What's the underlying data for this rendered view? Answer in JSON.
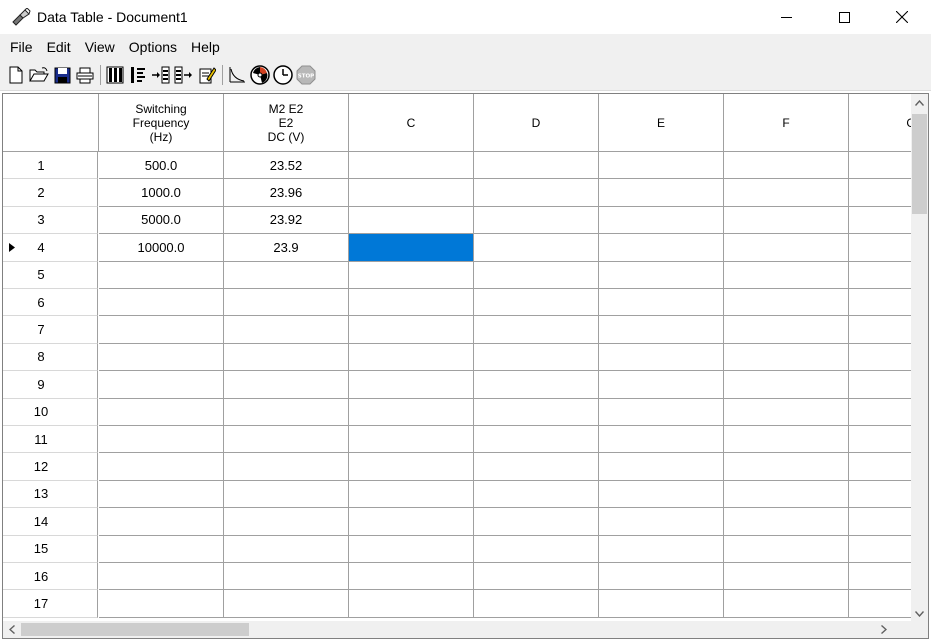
{
  "window": {
    "title": "Data Table - Document1"
  },
  "menu": [
    "File",
    "Edit",
    "View",
    "Options",
    "Help"
  ],
  "toolbar": {
    "icons": [
      "new-document-icon",
      "open-folder-icon",
      "save-disk-icon",
      "print-icon",
      "columns-icon",
      "column-options-icon",
      "insert-row-icon",
      "append-row-icon",
      "edit-notes-icon",
      "graph-icon",
      "meter-icon",
      "clock-icon",
      "stop-icon"
    ]
  },
  "table": {
    "columns": [
      {
        "label": "Switching\nFrequency\n(Hz)"
      },
      {
        "label": "M2 E2\nE2\nDC (V)"
      },
      {
        "label": "C"
      },
      {
        "label": "D"
      },
      {
        "label": "E"
      },
      {
        "label": "F"
      },
      {
        "label": "G"
      }
    ],
    "rows": [
      {
        "num": "1",
        "values": [
          "500.0",
          "23.52"
        ]
      },
      {
        "num": "2",
        "values": [
          "1000.0",
          "23.96"
        ]
      },
      {
        "num": "3",
        "values": [
          "5000.0",
          "23.92"
        ]
      },
      {
        "num": "4",
        "values": [
          "10000.0",
          "23.9"
        ]
      },
      {
        "num": "5",
        "values": [
          "",
          ""
        ]
      },
      {
        "num": "6",
        "values": [
          "",
          ""
        ]
      },
      {
        "num": "7",
        "values": [
          "",
          ""
        ]
      },
      {
        "num": "8",
        "values": [
          "",
          ""
        ]
      },
      {
        "num": "9",
        "values": [
          "",
          ""
        ]
      },
      {
        "num": "10",
        "values": [
          "",
          ""
        ]
      },
      {
        "num": "11",
        "values": [
          "",
          ""
        ]
      },
      {
        "num": "12",
        "values": [
          "",
          ""
        ]
      },
      {
        "num": "13",
        "values": [
          "",
          ""
        ]
      },
      {
        "num": "14",
        "values": [
          "",
          ""
        ]
      },
      {
        "num": "15",
        "values": [
          "",
          ""
        ]
      },
      {
        "num": "16",
        "values": [
          "",
          ""
        ]
      },
      {
        "num": "17",
        "values": [
          "",
          ""
        ]
      }
    ],
    "current_row": "4",
    "selected_cell": {
      "row": "4",
      "column": "C"
    },
    "selection_color": "#0078d7"
  }
}
